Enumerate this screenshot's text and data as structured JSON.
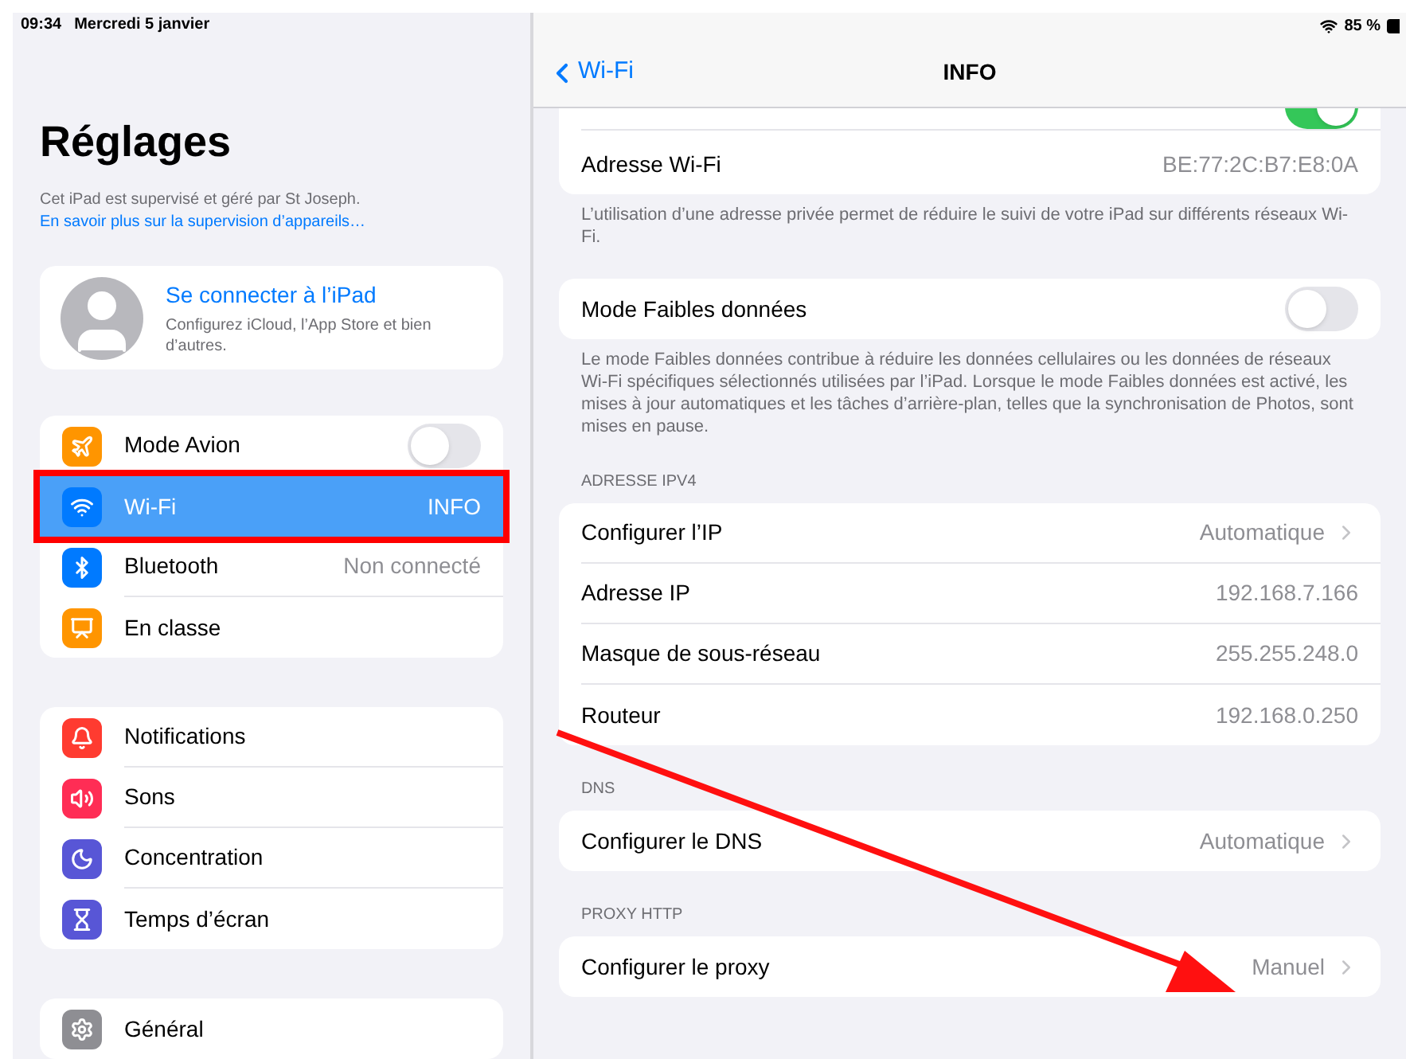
{
  "status_bar": {
    "time": "09:34",
    "date": "Mercredi 5 janvier",
    "battery": "85 %"
  },
  "sidebar": {
    "title": "Réglages",
    "note": "Cet iPad est supervisé et géré par St Joseph.",
    "note_link": "En savoir plus sur la supervision d’appareils…",
    "account": {
      "title": "Se connecter à l’iPad",
      "subtitle": "Configurez iCloud, l’App Store et bien d’autres."
    },
    "groups": [
      {
        "items": [
          {
            "label": "Mode Avion",
            "kind": "toggle",
            "on": false,
            "selected": false,
            "annotated": false,
            "color": "#ff9500"
          },
          {
            "label": "Wi-Fi",
            "kind": "value",
            "value": "INFO",
            "selected": true,
            "annotated": true,
            "color": "#007aff"
          },
          {
            "label": "Bluetooth",
            "kind": "value",
            "value": "Non connecté",
            "selected": false,
            "annotated": false,
            "color": "#007aff"
          },
          {
            "label": "En classe",
            "kind": "plain",
            "selected": false,
            "annotated": false,
            "color": "#ff9500"
          }
        ]
      },
      {
        "items": [
          {
            "label": "Notifications",
            "kind": "plain",
            "selected": false,
            "annotated": false,
            "color": "#ff3b30"
          },
          {
            "label": "Sons",
            "kind": "plain",
            "selected": false,
            "annotated": false,
            "color": "#ff2d55"
          },
          {
            "label": "Concentration",
            "kind": "plain",
            "selected": false,
            "annotated": false,
            "color": "#5856d6"
          },
          {
            "label": "Temps d’écran",
            "kind": "plain",
            "selected": false,
            "annotated": false,
            "color": "#5856d6"
          }
        ]
      },
      {
        "items": [
          {
            "label": "Général",
            "kind": "plain",
            "selected": false,
            "annotated": false,
            "color": "#8e8e93"
          }
        ]
      }
    ]
  },
  "detail": {
    "back": "Wi-Fi",
    "title": "INFO",
    "sections": [
      {
        "rows": [
          {
            "kind": "toggle",
            "on": true
          },
          {
            "kind": "value",
            "label": "Adresse Wi-Fi",
            "value": "BE:77:2C:B7:E8:0A"
          }
        ],
        "footer": "L’utilisation d’une adresse privée permet de réduire le suivi de votre iPad sur différents réseaux Wi-Fi."
      },
      {
        "rows": [
          {
            "kind": "toggle",
            "label": "Mode Faibles données",
            "on": false
          }
        ],
        "footer": "Le mode Faibles données contribue à réduire les données cellulaires ou les données de réseaux Wi-Fi spécifiques sélectionnés utilisées par l’iPad. Lorsque le mode Faibles données est activé, les mises à jour automatiques et les tâches d’arrière-plan, telles que la synchronisation de Photos, sont mises en pause."
      },
      {
        "header": "ADRESSE IPV4",
        "rows": [
          {
            "kind": "link",
            "label": "Configurer l’IP",
            "value": "Automatique"
          },
          {
            "kind": "value",
            "label": "Adresse IP",
            "value": "192.168.7.166"
          },
          {
            "kind": "value",
            "label": "Masque de sous-réseau",
            "value": "255.255.248.0"
          },
          {
            "kind": "value",
            "label": "Routeur",
            "value": "192.168.0.250"
          }
        ]
      },
      {
        "header": "DNS",
        "rows": [
          {
            "kind": "link",
            "label": "Configurer le DNS",
            "value": "Automatique"
          }
        ]
      },
      {
        "header": "PROXY HTTP",
        "rows": [
          {
            "kind": "link",
            "label": "Configurer le proxy",
            "value": "Manuel"
          }
        ]
      }
    ]
  }
}
